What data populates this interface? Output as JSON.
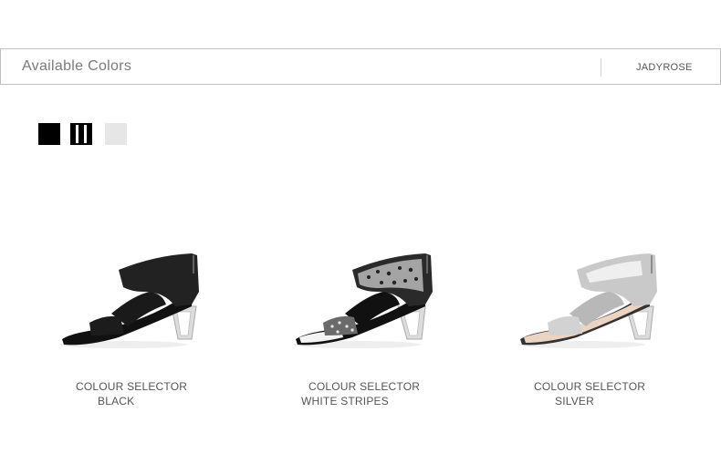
{
  "header": {
    "title": "Available Colors",
    "brand": "JADYROSE"
  },
  "swatches": [
    {
      "name": "black",
      "color": "#000000"
    },
    {
      "name": "white-stripes",
      "color": "#000000"
    },
    {
      "name": "silver",
      "color": "#e6e6e6"
    }
  ],
  "products": [
    {
      "line1": "COLOUR SELECTOR",
      "line2": "BLACK"
    },
    {
      "line1": "COLOUR SELECTOR",
      "line2": "WHITE STRIPES"
    },
    {
      "line1": "COLOUR SELECTOR",
      "line2": "SILVER"
    }
  ]
}
